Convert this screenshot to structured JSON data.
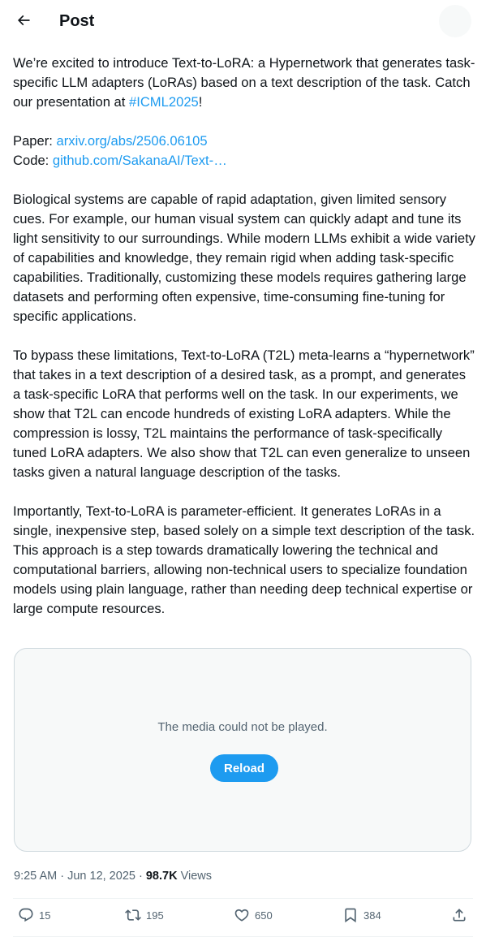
{
  "header": {
    "title": "Post",
    "back_icon": "arrow-left-icon"
  },
  "post": {
    "para1": {
      "text_before": "We’re excited to introduce Text-to-LoRA: a Hypernetwork that generates task-specific LLM adapters (LoRAs) based on a text description of the task. Catch our presentation at ",
      "hashtag": "#ICML2025",
      "text_after": "!"
    },
    "links": {
      "paper_label": "Paper: ",
      "paper_url": "arxiv.org/abs/2506.06105",
      "code_label": "Code: ",
      "code_url": "github.com/SakanaAI/Text-…"
    },
    "para2": "Biological systems are capable of rapid adaptation, given limited sensory cues. For example, our human visual system can quickly adapt and tune its light sensitivity to our surroundings. While modern LLMs exhibit a wide variety of capabilities and knowledge, they remain rigid when adding task-specific capabilities. Traditionally, customizing these models requires gathering large datasets and performing often expensive, time-consuming fine-tuning for specific applications.",
    "para3": "To bypass these limitations, Text-to-LoRA (T2L) meta-learns a “hypernetwork” that takes in a text description of a desired task, as a prompt, and generates a task-specific LoRA that performs well on the task. In our experiments, we show that T2L can encode hundreds of existing LoRA adapters. While the compression is lossy, T2L maintains the performance of task-specifically tuned LoRA adapters. We also show that T2L can even generalize to unseen tasks given a natural language description of the tasks.",
    "para4": "Importantly, Text-to-LoRA is parameter-efficient. It generates LoRAs in a single, inexpensive step, based solely on a simple text description of the task. This approach is a step towards dramatically lowering the technical and computational barriers, allowing non-technical users to specialize foundation models using plain language, rather than needing deep technical expertise or large compute resources."
  },
  "media": {
    "message": "The media could not be played.",
    "reload_label": "Reload"
  },
  "meta": {
    "time": "9:25 AM",
    "sep1": " · ",
    "date": "Jun 12, 2025",
    "sep2": " · ",
    "views_count": "98.7K",
    "views_label": " Views"
  },
  "actions": {
    "replies": "15",
    "reposts": "195",
    "likes": "650",
    "bookmarks": "384",
    "icons": [
      "reply-icon",
      "repost-icon",
      "like-icon",
      "bookmark-icon",
      "share-icon"
    ]
  },
  "colors": {
    "link": "#1d9bf0",
    "text": "#0f1419",
    "secondary": "#536471",
    "border": "#cfd9de"
  }
}
